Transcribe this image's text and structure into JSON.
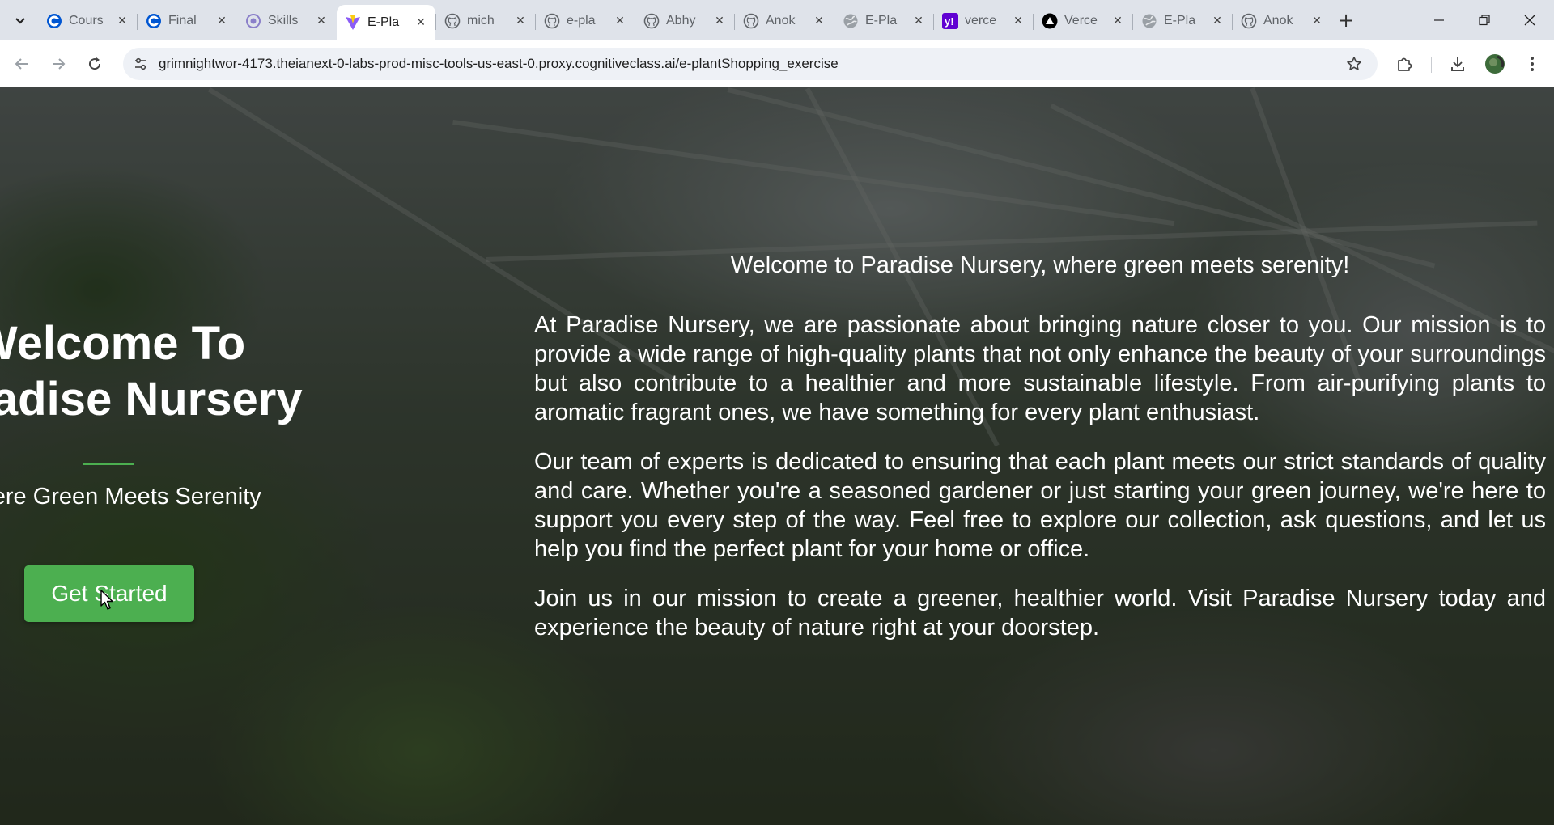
{
  "browser": {
    "tabs": [
      {
        "title": "Cours",
        "icon": "coursera-icon"
      },
      {
        "title": "Final",
        "icon": "coursera-icon"
      },
      {
        "title": "Skills",
        "icon": "skills-network-icon"
      },
      {
        "title": "E-Pla",
        "icon": "vite-icon",
        "active": true
      },
      {
        "title": "mich",
        "icon": "github-icon"
      },
      {
        "title": "e-pla",
        "icon": "github-icon"
      },
      {
        "title": "Abhy",
        "icon": "github-icon"
      },
      {
        "title": "Anok",
        "icon": "github-icon"
      },
      {
        "title": "E-Pla",
        "icon": "globe-icon"
      },
      {
        "title": "verce",
        "icon": "yahoo-icon"
      },
      {
        "title": "Verce",
        "icon": "vercel-icon"
      },
      {
        "title": "E-Pla",
        "icon": "globe-icon"
      },
      {
        "title": "Anok",
        "icon": "github-icon"
      }
    ],
    "url": "grimnightwor-4173.theianext-0-labs-prod-misc-tools-us-east-0.proxy.cognitiveclass.ai/e-plantShopping_exercise"
  },
  "hero": {
    "title_line1": "Welcome To",
    "title_line2": "Paradise Nursery",
    "tagline": "Where Green Meets Serenity",
    "button_label": "Get Started"
  },
  "about": {
    "heading": "Welcome to Paradise Nursery, where green meets serenity!",
    "paragraph1": "At Paradise Nursery, we are passionate about bringing nature closer to you. Our mission is to provide a wide range of high-quality plants that not only enhance the beauty of your surroundings but also contribute to a healthier and more sustainable lifestyle. From air-purifying plants to aromatic fragrant ones, we have something for every plant enthusiast.",
    "paragraph2": "Our team of experts is dedicated to ensuring that each plant meets our strict standards of quality and care. Whether you're a seasoned gardener or just starting your green journey, we're here to support you every step of the way. Feel free to explore our collection, ask questions, and let us help you find the perfect plant for your home or office.",
    "paragraph3": "Join us in our mission to create a greener, healthier world. Visit Paradise Nursery today and experience the beauty of nature right at your doorstep."
  },
  "colors": {
    "accent_green": "#4caf50",
    "tab_bar": "#dfe3ea",
    "text_on_image": "#ffffff"
  }
}
